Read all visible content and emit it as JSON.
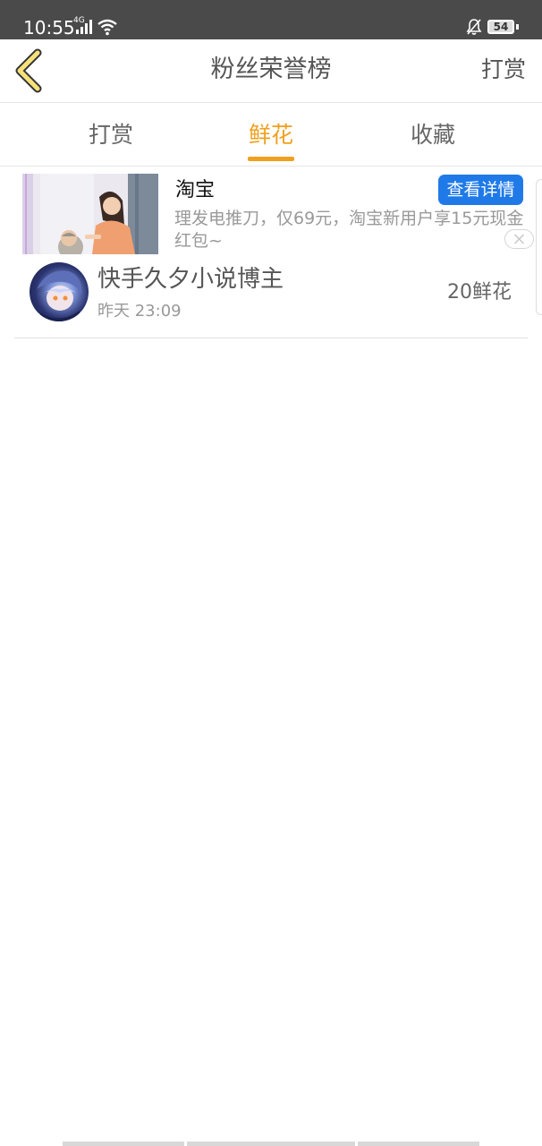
{
  "status_bar": {
    "time": "10:55",
    "network_label": "4G",
    "battery_level": 54,
    "battery_text": "54",
    "icons": [
      "signal-icon",
      "wifi-icon",
      "bell-muted-icon",
      "battery-icon"
    ]
  },
  "header": {
    "back_icon": "chevron-left-icon",
    "title": "粉丝荣誉榜",
    "action_label": "打赏"
  },
  "tabs": {
    "items": [
      {
        "label": "打赏",
        "active": false
      },
      {
        "label": "鲜花",
        "active": true
      },
      {
        "label": "收藏",
        "active": false
      }
    ],
    "active_color": "#f0a01e"
  },
  "ad": {
    "title": "淘宝",
    "button_label": "查看详情",
    "button_color": "#1f7ae8",
    "description": "理发电推刀，仅69元，淘宝新用户享15元现金红包~",
    "close_icon": "close-icon"
  },
  "fans": [
    {
      "name": "快手久夕小说博主",
      "time": "昨天 23:09",
      "amount": "20鲜花"
    }
  ]
}
